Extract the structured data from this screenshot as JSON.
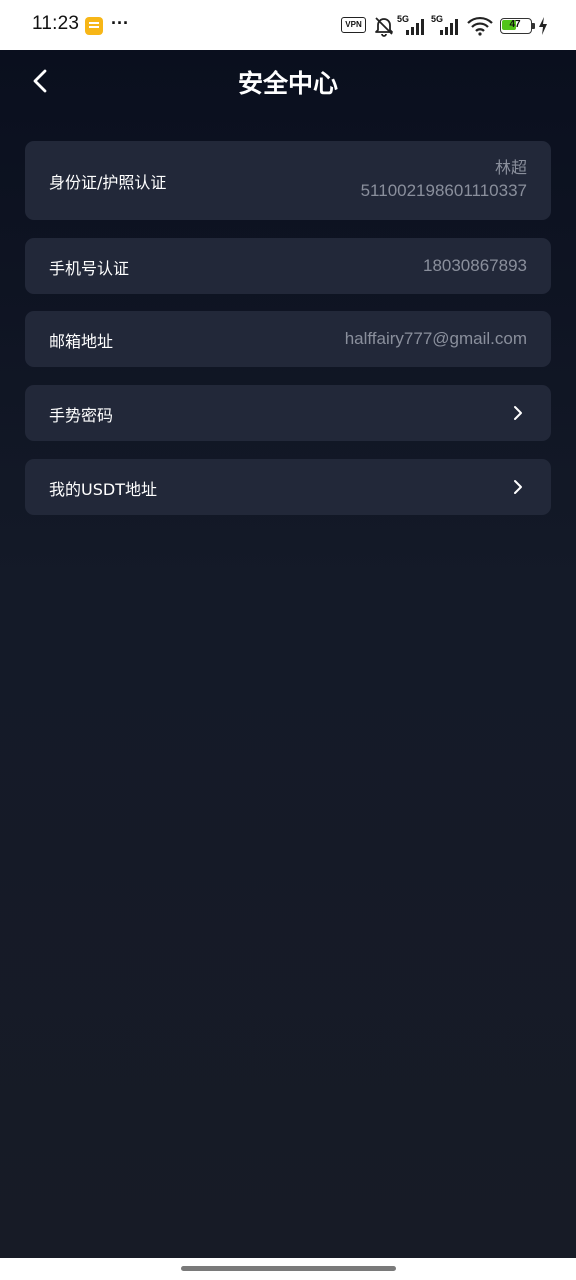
{
  "status_bar": {
    "time": "11:23",
    "vpn_label": "VPN",
    "signal1_label": "5G",
    "signal2_label": "5G",
    "battery_level": "47",
    "icons": [
      "note-app-icon",
      "more-dots-icon",
      "vpn-icon",
      "bell-muted-icon",
      "signal-icon",
      "wifi-icon",
      "battery-icon",
      "charging-icon"
    ],
    "more_indicator": "···"
  },
  "header": {
    "title": "安全中心",
    "back_icon": "chevron-left-icon"
  },
  "items": [
    {
      "label": "身份证/护照认证",
      "value_name": "林超",
      "value_number": "511002198601110337"
    },
    {
      "label": "手机号认证",
      "value": "18030867893"
    },
    {
      "label": "邮箱地址",
      "value": "halffairy777@gmail.com"
    },
    {
      "label": "手势密码",
      "icon": "chevron-right-icon"
    },
    {
      "label": "我的USDT地址",
      "icon": "chevron-right-icon"
    }
  ],
  "colors": {
    "background_top": "#0a0f1e",
    "background_bottom": "#171b26",
    "card": "#222839",
    "label": "#ffffff",
    "value": "#8a8f9c",
    "battery": "#52c41a"
  }
}
